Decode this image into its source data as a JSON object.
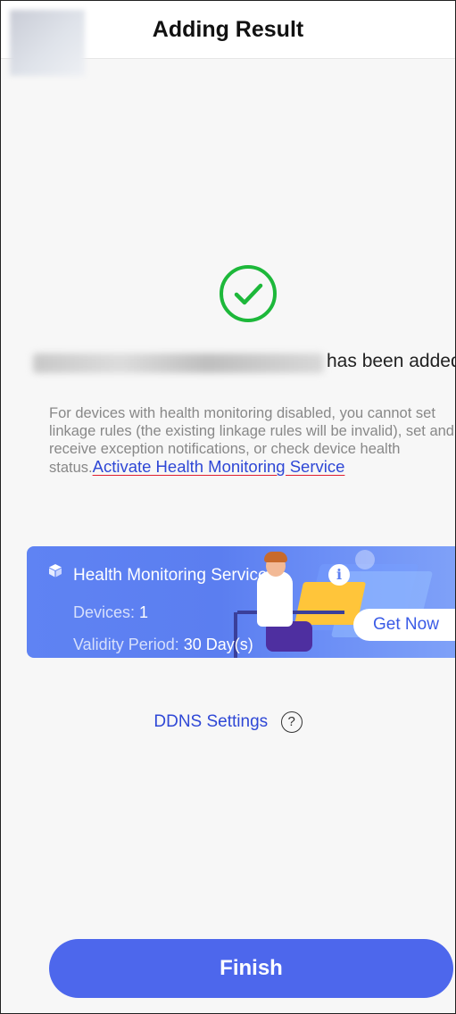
{
  "header": {
    "title": "Adding Result"
  },
  "result": {
    "status_icon": "check-circle-icon",
    "added_suffix": "has been added"
  },
  "notice": {
    "text": "For devices with health monitoring disabled, you cannot set linkage rules (the existing linkage rules will be invalid), set and receive exception notifications, or check device health status.",
    "link_text": "Activate Health Monitoring Service"
  },
  "health_card": {
    "title": "Health Monitoring Service",
    "devices_label": "Devices:",
    "devices_value": "1",
    "validity_label": "Validity Period:",
    "validity_value": "30 Day(s)",
    "get_now_label": "Get Now"
  },
  "ddns": {
    "label": "DDNS Settings"
  },
  "footer": {
    "finish_label": "Finish"
  },
  "colors": {
    "accent": "#4d67ec",
    "link": "#2f48d6",
    "success": "#1db83a",
    "card": "#5f83f3"
  }
}
